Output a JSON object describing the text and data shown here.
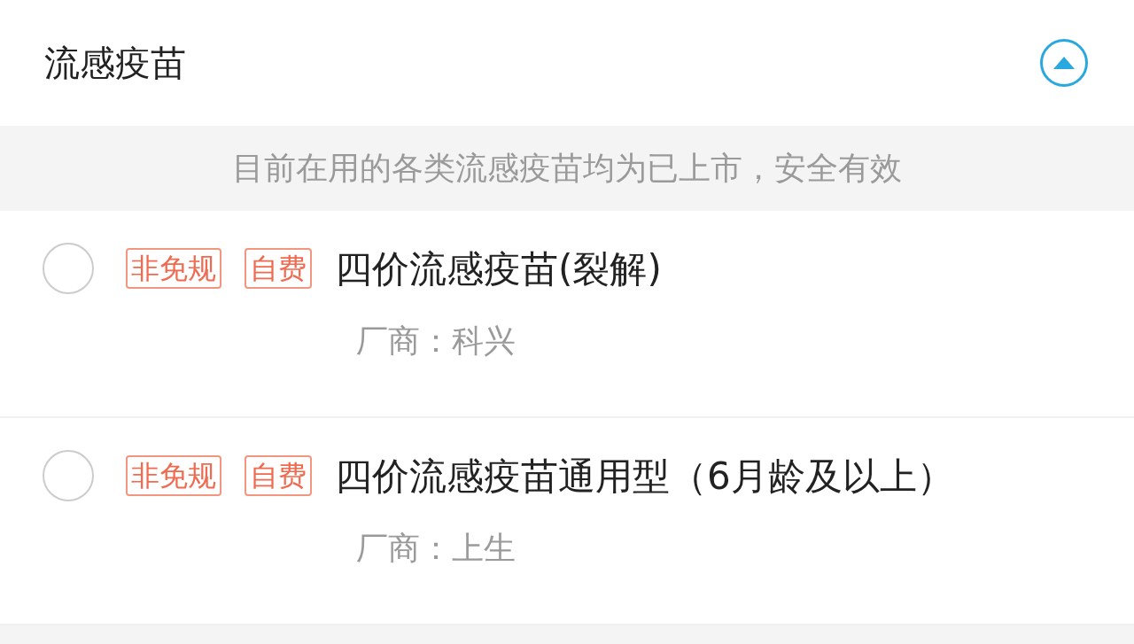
{
  "section": {
    "title": "流感疫苗",
    "expanded": true
  },
  "notice": "目前在用的各类流感疫苗均为已上市，安全有效",
  "vaccines": [
    {
      "selected": false,
      "tags": [
        "非免规",
        "自费"
      ],
      "name": "四价流感疫苗(裂解)",
      "maker": "厂商：科兴"
    },
    {
      "selected": false,
      "tags": [
        "非免规",
        "自费"
      ],
      "name": "四价流感疫苗通用型（6月龄及以上）",
      "maker": "厂商：上生"
    }
  ]
}
